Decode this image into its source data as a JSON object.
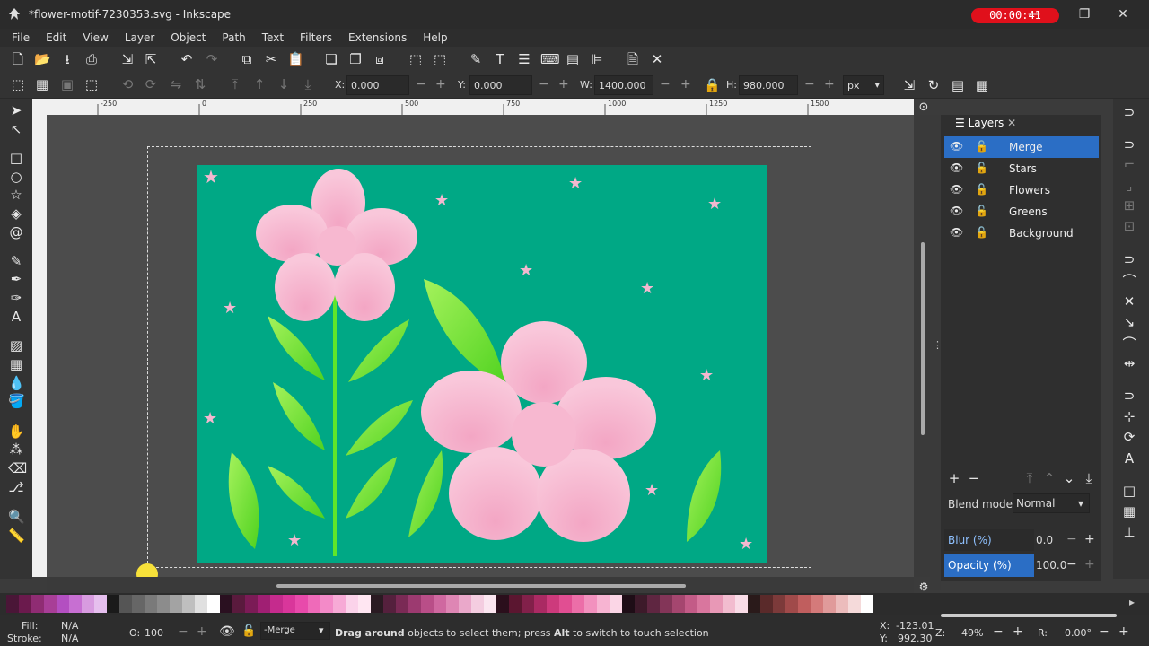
{
  "window": {
    "title": "*flower-motif-7230353.svg - Inkscape",
    "timer": "00:00:41"
  },
  "menu": [
    "File",
    "Edit",
    "View",
    "Layer",
    "Object",
    "Path",
    "Text",
    "Filters",
    "Extensions",
    "Help"
  ],
  "toolcontrols": {
    "x_label": "X:",
    "x_value": "0.000",
    "y_label": "Y:",
    "y_value": "0.000",
    "w_label": "W:",
    "w_value": "1400.000",
    "h_label": "H:",
    "h_value": "980.000",
    "unit": "px"
  },
  "ruler": {
    "ticks": [
      "-250",
      "0",
      "250",
      "500",
      "750",
      "1000",
      "1250",
      "1500"
    ]
  },
  "layers_panel": {
    "tab_label": "Layers",
    "layers": [
      {
        "name": "Merge",
        "selected": true
      },
      {
        "name": "Stars",
        "selected": false
      },
      {
        "name": "Flowers",
        "selected": false
      },
      {
        "name": "Greens",
        "selected": false
      },
      {
        "name": "Background",
        "selected": false
      }
    ],
    "blend_label": "Blend mode:",
    "blend_value": "Normal",
    "blur_label": "Blur (%)",
    "blur_value": "0.0",
    "opacity_label": "Opacity (%)",
    "opacity_value": "100.0"
  },
  "palette_colors": [
    "#4a1637",
    "#6b1a4d",
    "#8f2c73",
    "#a83e97",
    "#b34fc1",
    "#c76fd2",
    "#d89be0",
    "#e6bfee",
    "#1a1a1a",
    "#555555",
    "#666666",
    "#7a7a7a",
    "#8c8c8c",
    "#a3a3a3",
    "#bfbfbf",
    "#e0e0e0",
    "#ffffff",
    "#2a1020",
    "#5a1a3d",
    "#7b1b56",
    "#a01f73",
    "#c52b8d",
    "#d9369b",
    "#e84aab",
    "#ef6ab9",
    "#f38ac8",
    "#f7aad6",
    "#fbd3ea",
    "#ffe6f2",
    "#2a1a22",
    "#55203d",
    "#7a2a55",
    "#9c3a70",
    "#b94e88",
    "#cf68a0",
    "#de86b4",
    "#eaa8ca",
    "#f4cde0",
    "#fbe6f0",
    "#2b0f1c",
    "#5b1630",
    "#82204a",
    "#aa2a63",
    "#cd3a7c",
    "#e14e92",
    "#ec6ea8",
    "#f291be",
    "#f7b4d2",
    "#fbd6e6",
    "#1e0d16",
    "#3d1a2a",
    "#5f2641",
    "#833558",
    "#a5466f",
    "#c35b87",
    "#d9769e",
    "#e898b6",
    "#f2bccf",
    "#f9dce7",
    "#2a1a1a",
    "#5a2a2a",
    "#7c3a3a",
    "#a04a4a",
    "#c05e5e",
    "#d47a7a",
    "#e09a9a",
    "#ecbcbc",
    "#f5dada",
    "#ffffff"
  ],
  "status": {
    "fill_label": "Fill:",
    "fill_value": "N/A",
    "stroke_label": "Stroke:",
    "stroke_value": "N/A",
    "opacity_label": "O:",
    "opacity_value": "100",
    "layer_dropdown": "-Merge",
    "message_bold": "Drag around",
    "message_rest": " objects to select them; press ",
    "message_bold2": "Alt",
    "message_rest2": " to switch to touch selection",
    "x_label": "X:",
    "x_value": "-123.01",
    "y_label": "Y:",
    "y_value": "992.30",
    "zoom_label": "Z:",
    "zoom_value": "49%",
    "rotate_label": "R:",
    "rotate_value": "0.00°"
  }
}
